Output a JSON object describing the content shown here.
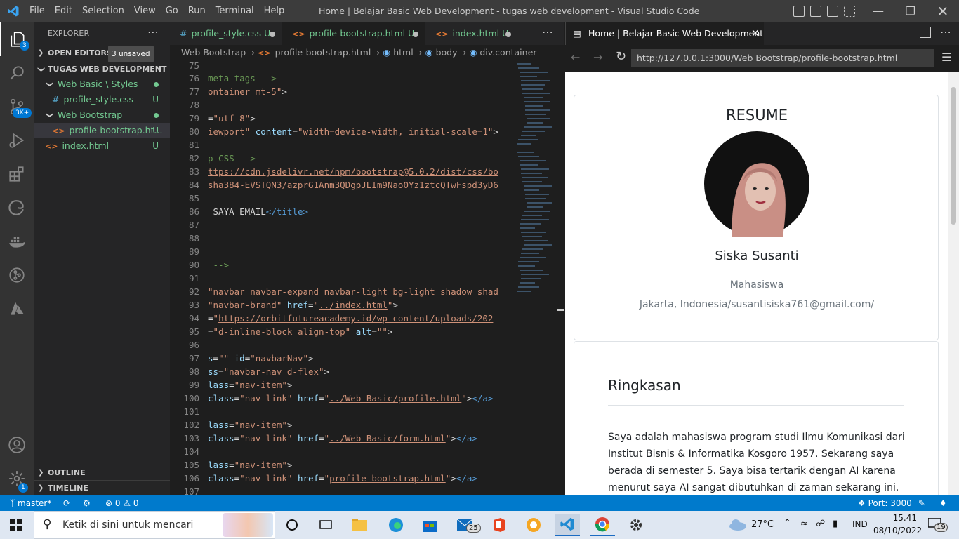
{
  "titlebar": {
    "menu": [
      "File",
      "Edit",
      "Selection",
      "View",
      "Go",
      "Run",
      "Terminal",
      "Help"
    ],
    "title": "Home | Belajar Basic Web Development - tugas web development - Visual Studio Code"
  },
  "activity": {
    "explorer_badge": "3",
    "scm_badge": "3K+",
    "settings_badge": "1"
  },
  "sidebar": {
    "header": "EXPLORER",
    "open_editors": "OPEN EDITORS",
    "unsaved": "3 unsaved",
    "project": "TUGAS WEB DEVELOPMENT",
    "folder1": "Web Basic",
    "folder1_sub": "Styles",
    "file1": "profile_style.css",
    "folder2": "Web Bootstrap",
    "file2": "profile-bootstrap.ht...",
    "file3": "index.html",
    "u": "U",
    "outline": "OUTLINE",
    "timeline": "TIMELINE"
  },
  "tabs": [
    {
      "label": "profile_style.css",
      "status": "U"
    },
    {
      "label": "profile-bootstrap.html",
      "status": "U"
    },
    {
      "label": "index.html",
      "status": "U"
    }
  ],
  "breadcrumb": [
    "Web Bootstrap",
    "profile-bootstrap.html",
    "html",
    "body",
    "div.container"
  ],
  "code": {
    "lines": [
      {
        "n": "75"
      },
      {
        "n": "76"
      },
      {
        "n": "77"
      },
      {
        "n": "78"
      },
      {
        "n": "79"
      },
      {
        "n": "80"
      },
      {
        "n": "81"
      },
      {
        "n": "82"
      },
      {
        "n": "83"
      },
      {
        "n": "84"
      },
      {
        "n": "85"
      },
      {
        "n": "86"
      },
      {
        "n": "87"
      },
      {
        "n": "88"
      },
      {
        "n": "89"
      },
      {
        "n": "90"
      },
      {
        "n": "91"
      },
      {
        "n": "92"
      },
      {
        "n": "93"
      },
      {
        "n": "94"
      },
      {
        "n": "95"
      },
      {
        "n": "96"
      },
      {
        "n": "97"
      },
      {
        "n": "98"
      },
      {
        "n": "99"
      },
      {
        "n": "100"
      },
      {
        "n": "101"
      },
      {
        "n": "102"
      },
      {
        "n": "103"
      },
      {
        "n": "104"
      },
      {
        "n": "105"
      },
      {
        "n": "106"
      },
      {
        "n": "107"
      }
    ]
  },
  "preview": {
    "tab_title": "Home | Belajar Basic Web Development",
    "url": "http://127.0.0.1:3000/Web Bootstrap/profile-bootstrap.html",
    "resume_title": "RESUME",
    "name": "Siska Susanti",
    "role": "Mahasiswa",
    "contact": "Jakarta, Indonesia/susantisiska761@gmail.com/",
    "summary_title": "Ringkasan",
    "summary_text": "Saya adalah mahasiswa program studi Ilmu Komunikasi dari Institut Bisnis & Informatika Kosgoro 1957. Sekarang saya berada di semester 5. Saya bisa tertarik dengan AI karena menurut saya AI sangat dibutuhkan di zaman sekarang ini."
  },
  "status": {
    "branch": "master*",
    "problems": "0",
    "warnings": "0",
    "port": "Port: 3000"
  },
  "taskbar": {
    "search_placeholder": "Ketik di sini untuk mencari",
    "mail_badge": "25",
    "weather": "27°C",
    "lang": "IND",
    "time": "15.41",
    "date": "08/10/2022",
    "notif": "19"
  }
}
